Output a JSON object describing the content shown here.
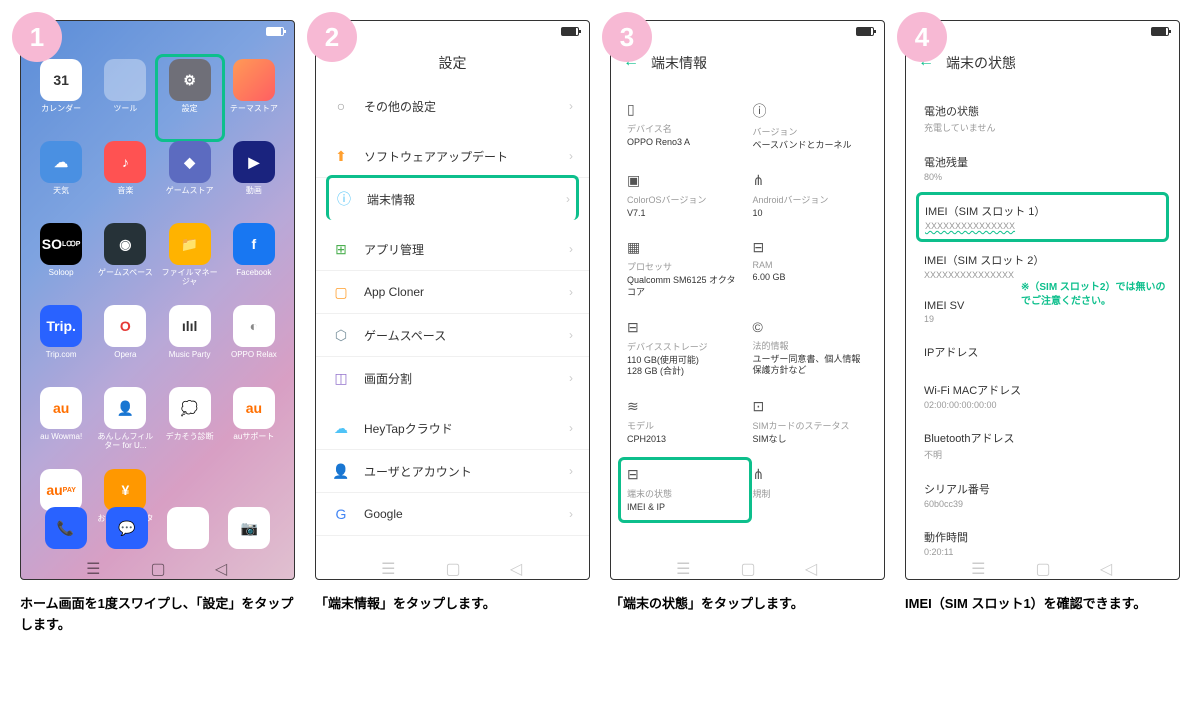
{
  "steps": [
    {
      "num": "1",
      "caption": "ホーム画面を1度スワイプし、「設定」をタップします。"
    },
    {
      "num": "2",
      "caption": "「端末情報」をタップします。"
    },
    {
      "num": "3",
      "caption": "「端末の状態」をタップします。"
    },
    {
      "num": "4",
      "caption": "IMEI（SIM スロット1）を確認できます。"
    }
  ],
  "step1": {
    "apps": [
      {
        "label": "カレンダー",
        "text": "31",
        "bg": "#fff",
        "fg": "#333"
      },
      {
        "label": "ツール",
        "text": "",
        "bg": "rgba(255,255,255,.35)"
      },
      {
        "label": "設定",
        "text": "⚙",
        "bg": "#6f6f78",
        "highlight": true
      },
      {
        "label": "テーマストア",
        "text": "",
        "bg": "linear-gradient(135deg,#ff9a56,#ff5e62)"
      },
      {
        "label": "天気",
        "text": "☁",
        "bg": "#4a90e2"
      },
      {
        "label": "音楽",
        "text": "♪",
        "bg": "#ff5252"
      },
      {
        "label": "ゲームストア",
        "text": "◆",
        "bg": "#5c6bc0"
      },
      {
        "label": "動画",
        "text": "▶",
        "bg": "#1a237e"
      },
      {
        "label": "Soloop",
        "text": "SO",
        "bg": "#000",
        "sub": "LꝎP"
      },
      {
        "label": "ゲームスペース",
        "text": "◉",
        "bg": "#263238"
      },
      {
        "label": "ファイルマネージャ",
        "text": "📁",
        "bg": "#ffb300"
      },
      {
        "label": "Facebook",
        "text": "f",
        "bg": "#1877f2"
      },
      {
        "label": "Trip.com",
        "text": "Trip.",
        "bg": "#2962ff"
      },
      {
        "label": "Opera",
        "text": "O",
        "bg": "#fff",
        "fg": "#e53935"
      },
      {
        "label": "Music Party",
        "text": "ılıl",
        "bg": "#fff",
        "fg": "#333"
      },
      {
        "label": "OPPO Relax",
        "text": "◐",
        "bg": "#fff",
        "fg": "#888"
      },
      {
        "label": "au Wowma!",
        "text": "au",
        "bg": "#fff",
        "fg": "#ff6f00"
      },
      {
        "label": "あんしんフィルター for U...",
        "text": "👤",
        "bg": "#fff"
      },
      {
        "label": "デカそう診断",
        "text": "💭",
        "bg": "#fff"
      },
      {
        "label": "auサポート",
        "text": "au",
        "bg": "#fff",
        "fg": "#ff6f00"
      },
      {
        "label": "au PAY",
        "text": "au",
        "bg": "#fff",
        "fg": "#ff6f00",
        "sub": "PAY"
      },
      {
        "label": "おサイフケータイ",
        "text": "¥",
        "bg": "#ff9800"
      }
    ],
    "dock": [
      {
        "name": "phone",
        "bg": "#2962ff",
        "text": "📞"
      },
      {
        "name": "messages",
        "bg": "#2962ff",
        "text": "💬"
      },
      {
        "name": "chrome",
        "bg": "#fff",
        "text": "◉"
      },
      {
        "name": "camera",
        "bg": "#fff",
        "text": "📷"
      }
    ]
  },
  "step2": {
    "title": "設定",
    "items": [
      {
        "icon": "○",
        "color": "#999",
        "label": "その他の設定",
        "gap": true
      },
      {
        "icon": "⬆",
        "color": "#ff9f2e",
        "label": "ソフトウェアアップデート"
      },
      {
        "icon": "ⓘ",
        "color": "#4fc3f7",
        "label": "端末情報",
        "gap": true,
        "highlight": true
      },
      {
        "icon": "⊞",
        "color": "#4caf50",
        "label": "アプリ管理"
      },
      {
        "icon": "▢",
        "color": "#ff9f2e",
        "label": "App Cloner"
      },
      {
        "icon": "⬡",
        "color": "#78909c",
        "label": "ゲームスペース"
      },
      {
        "icon": "◫",
        "color": "#9575cd",
        "label": "画面分割",
        "gap": true
      },
      {
        "icon": "☁",
        "color": "#4fc3f7",
        "label": "HeyTapクラウド"
      },
      {
        "icon": "👤",
        "color": "#78909c",
        "label": "ユーザとアカウント"
      },
      {
        "icon": "G",
        "color": "#4285f4",
        "label": "Google"
      }
    ]
  },
  "step3": {
    "title": "端末情報",
    "items": [
      {
        "icon": "▯",
        "label": "デバイス名",
        "value": "OPPO Reno3 A"
      },
      {
        "icon": "ⓘ",
        "label": "バージョン",
        "value": "ベースバンドとカーネル"
      },
      {
        "icon": "▣",
        "label": "ColorOSバージョン",
        "value": "V7.1"
      },
      {
        "icon": "⋔",
        "label": "Androidバージョン",
        "value": "10"
      },
      {
        "icon": "▦",
        "label": "プロセッサ",
        "value": "Qualcomm SM6125 オクタコア"
      },
      {
        "icon": "⊟",
        "label": "RAM",
        "value": "6.00 GB"
      },
      {
        "icon": "⊟",
        "label": "デバイスストレージ",
        "value": "110 GB(使用可能)\n128 GB (合計)"
      },
      {
        "icon": "©",
        "label": "法的情報",
        "value": "ユーザー同意書、個人情報保護方針など"
      },
      {
        "icon": "≋",
        "label": "モデル",
        "value": "CPH2013"
      },
      {
        "icon": "⊡",
        "label": "SIMカードのステータス",
        "value": "SIMなし"
      },
      {
        "icon": "⊟",
        "label": "端末の状態",
        "value": "IMEI & IP",
        "highlight": true
      },
      {
        "icon": "⋔",
        "label": "規制",
        "value": ""
      }
    ]
  },
  "step4": {
    "title": "端末の状態",
    "note": "※（SIM スロット2）では無いのでご注意ください。",
    "items": [
      {
        "label": "電池の状態",
        "value": "充電していません"
      },
      {
        "label": "電池残量",
        "value": "80%"
      },
      {
        "label": "IMEI（SIM スロット 1）",
        "value": "XXXXXXXXXXXXXXX",
        "highlight": true,
        "wavy": true
      },
      {
        "label": "IMEI（SIM スロット 2）",
        "value": "XXXXXXXXXXXXXXX"
      },
      {
        "label": "IMEI SV",
        "value": "19"
      },
      {
        "label": "IPアドレス",
        "value": ""
      },
      {
        "label": "Wi-Fi MACアドレス",
        "value": "02:00:00:00:00:00"
      },
      {
        "label": "Bluetoothアドレス",
        "value": "不明"
      },
      {
        "label": "シリアル番号",
        "value": "60b0cc39"
      },
      {
        "label": "動作時間",
        "value": "0:20:11"
      }
    ]
  }
}
